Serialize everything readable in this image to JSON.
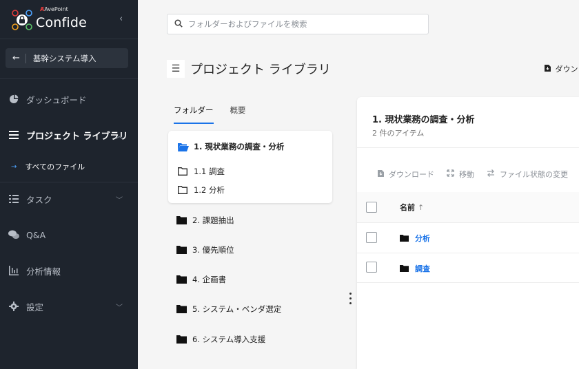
{
  "brand": {
    "company": "AvePoint",
    "product": "Confide"
  },
  "sidebar": {
    "back_label": "基幹システム導入",
    "items": [
      {
        "label": "ダッシュボード",
        "icon": "pie-chart-icon"
      },
      {
        "label": "プロジェクト ライブラリ",
        "icon": "list-icon"
      },
      {
        "label": "タスク",
        "icon": "task-list-icon"
      },
      {
        "label": "Q&A",
        "icon": "chat-icon"
      },
      {
        "label": "分析情報",
        "icon": "bar-chart-icon"
      },
      {
        "label": "設定",
        "icon": "gear-icon"
      }
    ],
    "sub_item": "すべてのファイル"
  },
  "search": {
    "placeholder": "フォルダーおよびファイルを検索"
  },
  "page": {
    "title": "プロジェクト ライブラリ",
    "download": "ダウンロ"
  },
  "tabs": [
    "フォルダー",
    "概要"
  ],
  "folders": {
    "current": "1. 現状業務の調査・分析",
    "children": [
      "1.1 調査",
      "1.2 分析"
    ],
    "others": [
      "2. 課題抽出",
      "3. 優先順位",
      "4. 企画書",
      "5. システム・ベンダ選定",
      "6. システム導入支援"
    ]
  },
  "content": {
    "title": "1. 現状業務の調査・分析",
    "count": "2 件のアイテム",
    "toolbar": [
      "ダウンロード",
      "移動",
      "ファイル状態の変更"
    ],
    "column_name": "名前",
    "sort_indicator": "↑",
    "rows": [
      "分析",
      "調査"
    ]
  },
  "colors": {
    "sidebar_bg": "#1e242d",
    "accent": "#1a73e8",
    "brand_red": "#e23b3b"
  }
}
